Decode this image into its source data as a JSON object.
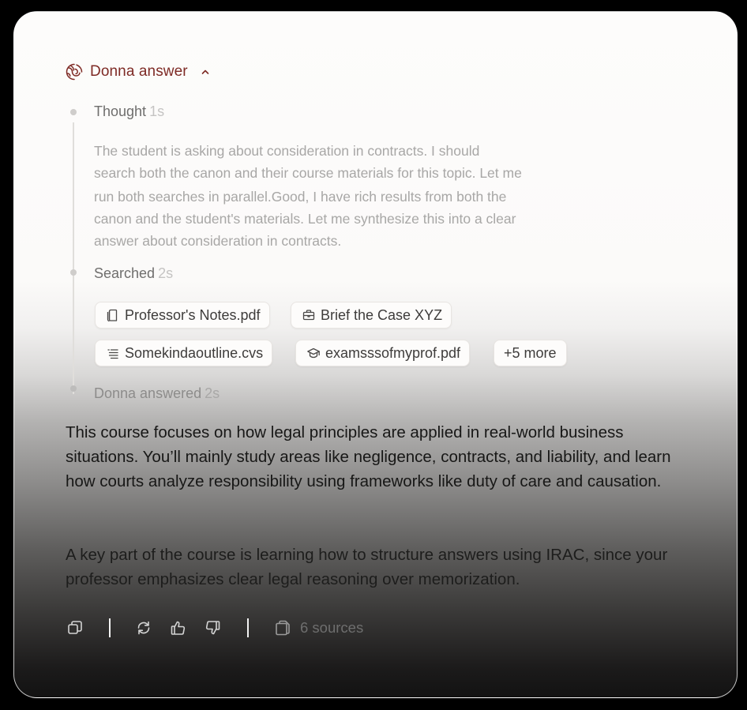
{
  "header": {
    "title": "Donna answer"
  },
  "steps": {
    "thought": {
      "label": "Thought",
      "time": "1s",
      "lines": [
        "The student is asking about consideration in contracts. I should",
        "search both the canon and their course materials for this topic. Let me",
        "run both searches in parallel.Good, I have rich results from both the",
        "canon and the student's materials. Let me synthesize this into a clear",
        "answer about consideration in contracts."
      ]
    },
    "searched": {
      "label": "Searched",
      "time": "2s",
      "files": [
        {
          "name": "Professor's Notes.pdf",
          "icon": "document-icon"
        },
        {
          "name": "Brief the Case XYZ",
          "icon": "briefcase-icon"
        },
        {
          "name": "Somekindaoutline.cvs",
          "icon": "list-icon"
        },
        {
          "name": "examsssofmyprof.pdf",
          "icon": "graduation-cap-icon"
        }
      ],
      "more_label": "+5 more"
    },
    "answered": {
      "label": "Donna answered",
      "time": "2s"
    }
  },
  "answer": {
    "paragraph1": "This course focuses on how legal principles are applied in real-world business situations. You’ll mainly study areas like negligence, contracts, and liability, and learn how courts analyze responsibility using frameworks like duty of care and causation.",
    "paragraph2": "A key part of the course is learning how to structure answers using IRAC, since your professor emphasizes clear legal reasoning over memorization."
  },
  "actions": {
    "icons": [
      "copy-icon",
      "regenerate-icon",
      "thumbs-up-icon",
      "thumbs-down-icon",
      "sources-icon"
    ],
    "sources_label": "6 sources"
  },
  "colors": {
    "accent": "#7e2b25",
    "text_primary": "#171716",
    "text_muted": "#a8a7a6",
    "chip_border": "#e8e5e2"
  }
}
